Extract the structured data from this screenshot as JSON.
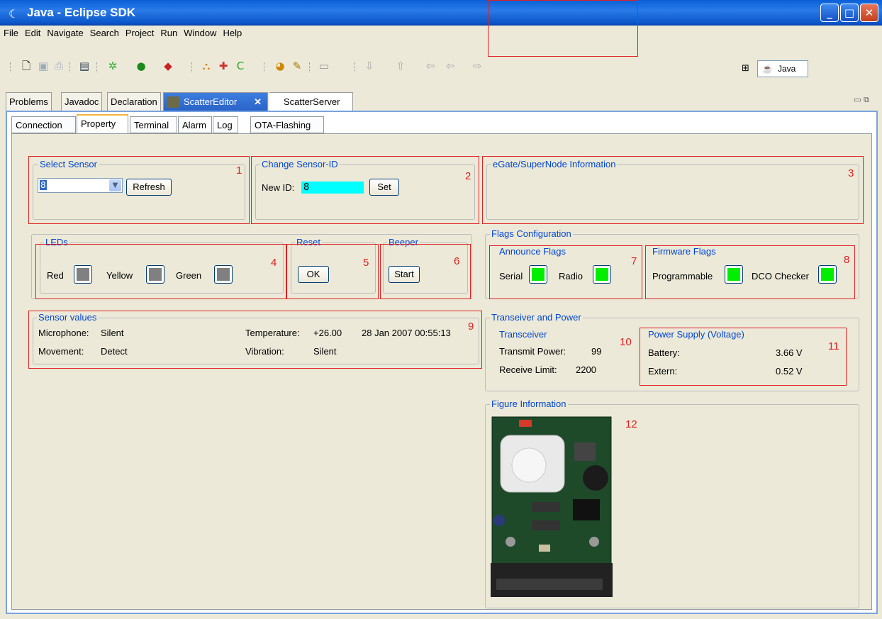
{
  "window": {
    "title": "Java - Eclipse SDK"
  },
  "menu": [
    "File",
    "Edit",
    "Navigate",
    "Search",
    "Project",
    "Run",
    "Window",
    "Help"
  ],
  "perspective": {
    "label": "Java"
  },
  "view_tabs": [
    "Problems",
    "Javadoc",
    "Declaration",
    "ScatterEditor",
    "ScatterServer"
  ],
  "property_tabs": [
    "Connection",
    "Property",
    "Terminal",
    "Alarm",
    "Log",
    "OTA-Flashing"
  ],
  "select_sensor": {
    "title": "Select Sensor",
    "value": "8",
    "refresh": "Refresh",
    "num": "1"
  },
  "change_id": {
    "title": "Change Sensor-ID",
    "label": "New ID:",
    "value": "8",
    "set": "Set",
    "num": "2"
  },
  "egate": {
    "title": "eGate/SuperNode Information",
    "num": "3"
  },
  "leds": {
    "title": "LEDs",
    "red": "Red",
    "yellow": "Yellow",
    "green": "Green",
    "num": "4",
    "state_color": "#808080"
  },
  "reset": {
    "title": "Reset",
    "ok": "OK",
    "num": "5"
  },
  "beeper": {
    "title": "Beeper",
    "start": "Start",
    "num": "6"
  },
  "flags": {
    "title": "Flags Configuration",
    "announce": {
      "title": "Announce Flags",
      "serial": "Serial",
      "radio": "Radio",
      "num": "7"
    },
    "firmware": {
      "title": "Firmware Flags",
      "programmable": "Programmable",
      "dco": "DCO Checker",
      "num": "8"
    },
    "on_color": "#00ee00"
  },
  "sensor_values": {
    "title": "Sensor values",
    "num": "9",
    "microphone_label": "Microphone:",
    "microphone": "Silent",
    "movement_label": "Movement:",
    "movement": "Detect",
    "temperature_label": "Temperature:",
    "temperature": "+26.00",
    "timestamp": "28 Jan 2007 00:55:13",
    "vibration_label": "Vibration:",
    "vibration": "Silent"
  },
  "transceiver_power": {
    "title": "Transeiver and Power"
  },
  "transceiver": {
    "title": "Transceiver",
    "num": "10",
    "tx_label": "Transmit Power:",
    "tx": "99",
    "rx_label": "Receive Limit:",
    "rx": "2200"
  },
  "power": {
    "title": "Power Supply (Voltage)",
    "num": "11",
    "battery_label": "Battery:",
    "battery": "3.66 V",
    "extern_label": "Extern:",
    "extern": "0.52 V"
  },
  "figure": {
    "title": "Figure Information",
    "num": "12"
  }
}
